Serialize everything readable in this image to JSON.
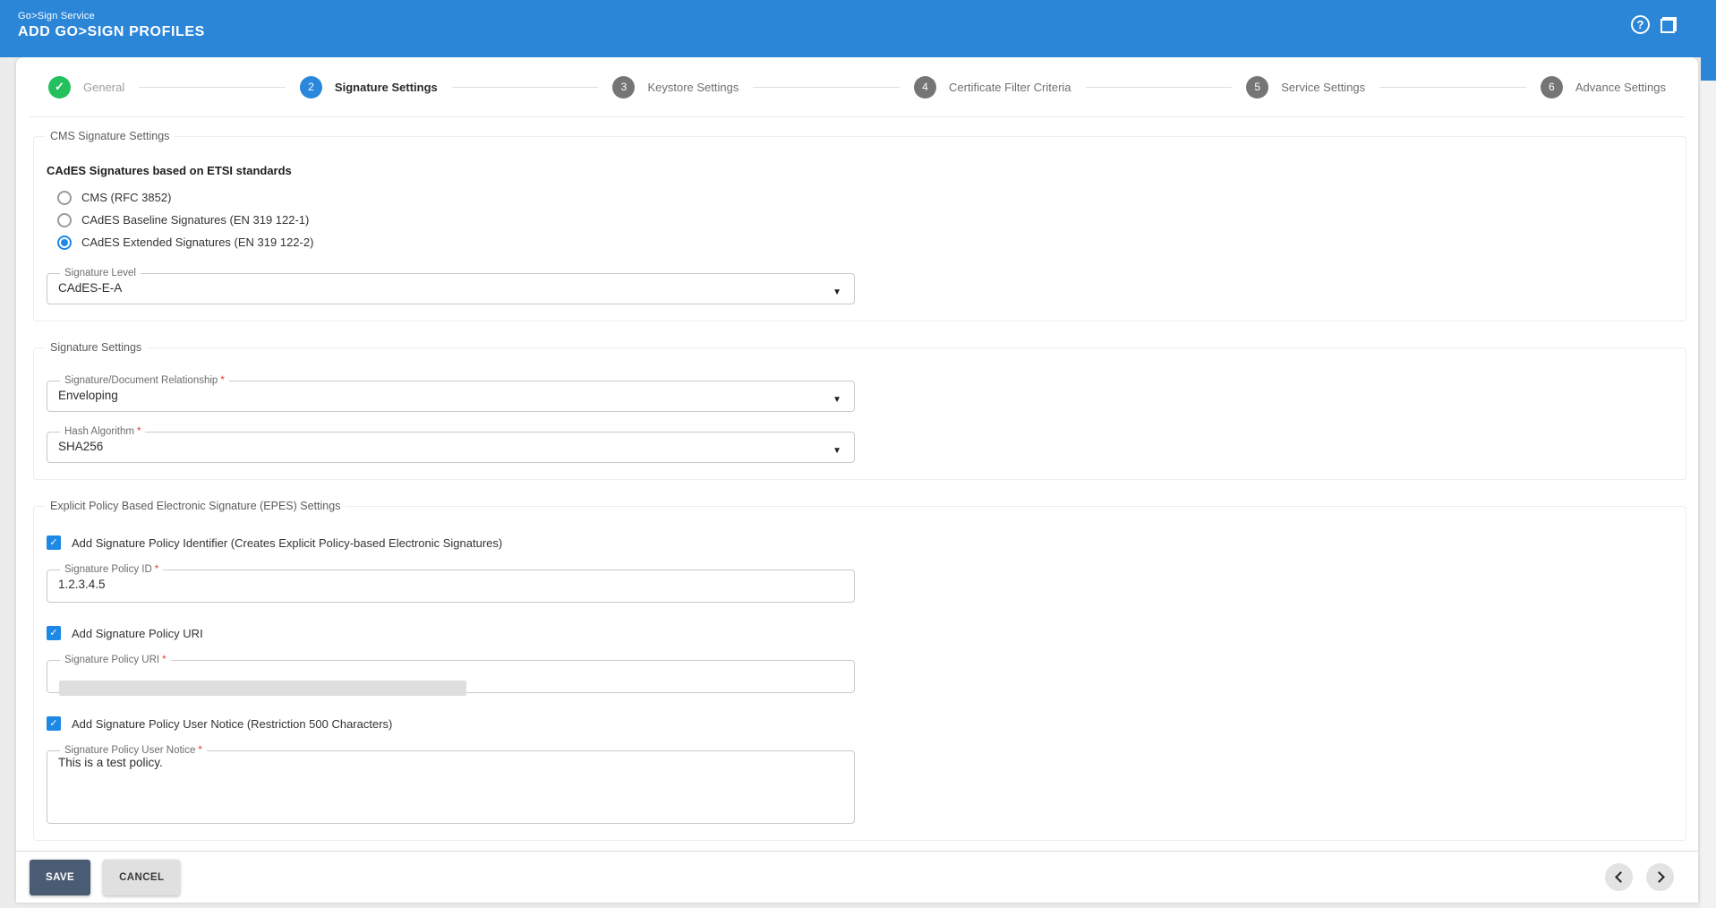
{
  "header": {
    "app_name": "Go>Sign Service",
    "page_title": "ADD GO>SIGN PROFILES"
  },
  "stepper": {
    "steps": [
      {
        "number": "",
        "label": "General",
        "state": "done"
      },
      {
        "number": "2",
        "label": "Signature Settings",
        "state": "active"
      },
      {
        "number": "3",
        "label": "Keystore Settings",
        "state": "todo"
      },
      {
        "number": "4",
        "label": "Certificate Filter Criteria",
        "state": "todo"
      },
      {
        "number": "5",
        "label": "Service Settings",
        "state": "todo"
      },
      {
        "number": "6",
        "label": "Advance Settings",
        "state": "todo"
      }
    ]
  },
  "sections": {
    "cms": {
      "legend": "CMS Signature Settings",
      "group_heading": "CAdES Signatures based on ETSI standards",
      "radios": [
        {
          "label": "CMS (RFC 3852)",
          "selected": false
        },
        {
          "label": "CAdES Baseline Signatures (EN 319 122-1)",
          "selected": false
        },
        {
          "label": "CAdES Extended Signatures (EN 319 122-2)",
          "selected": true
        }
      ],
      "signature_level": {
        "label": "Signature Level",
        "value": "CAdES-E-A",
        "required": false
      }
    },
    "signature": {
      "legend": "Signature Settings",
      "relationship": {
        "label": "Signature/Document Relationship",
        "value": "Enveloping",
        "required": true
      },
      "hash_algorithm": {
        "label": "Hash Algorithm",
        "value": "SHA256",
        "required": true
      }
    },
    "epes": {
      "legend": "Explicit Policy Based Electronic Signature (EPES) Settings",
      "identifier_checkbox": {
        "label": "Add Signature Policy Identifier (Creates Explicit Policy-based Electronic Signatures)",
        "checked": true
      },
      "policy_id": {
        "label": "Signature Policy ID",
        "value": "1.2.3.4.5",
        "required": true
      },
      "uri_checkbox": {
        "label": "Add Signature Policy URI",
        "checked": true
      },
      "policy_uri": {
        "label": "Signature Policy URI",
        "value": "",
        "redacted": true,
        "required": true
      },
      "notice_checkbox": {
        "label": "Add Signature Policy User Notice (Restriction 500 Characters)",
        "checked": true
      },
      "user_notice": {
        "label": "Signature Policy User Notice",
        "value": "This is a test policy.",
        "required": true
      }
    }
  },
  "footer": {
    "save_label": "SAVE",
    "cancel_label": "CANCEL"
  },
  "misc": {
    "required_marker": "*"
  },
  "colors": {
    "header_blue": "#2B86D8",
    "active_step_blue": "#2A87DC",
    "accent_blue": "#1E88E5",
    "success_green": "#23C05E",
    "save_button": "#4A5B74",
    "required_red": "#E53935"
  }
}
